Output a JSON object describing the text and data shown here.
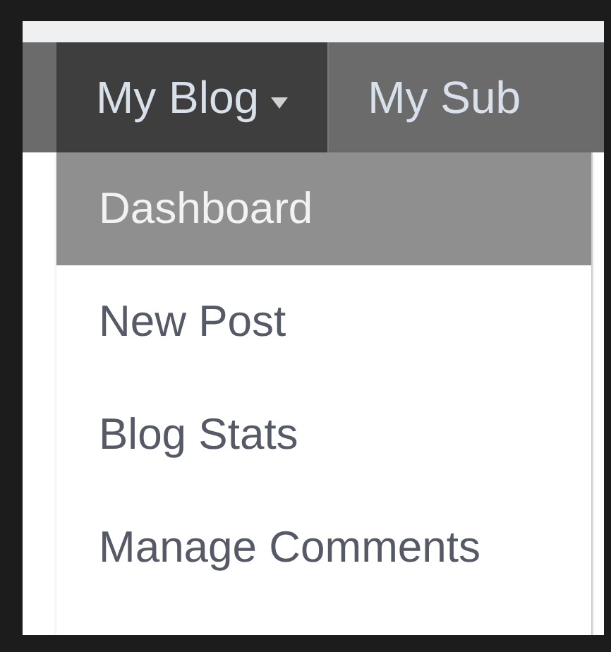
{
  "nav": {
    "tabs": [
      {
        "label": "My Blog",
        "selected": true,
        "has_caret": true
      },
      {
        "label": "My Sub",
        "selected": false,
        "has_caret": false
      }
    ]
  },
  "menu": {
    "items": [
      {
        "label": "Dashboard",
        "selected": true
      },
      {
        "label": "New Post",
        "selected": false
      },
      {
        "label": "Blog Stats",
        "selected": false
      },
      {
        "label": "Manage Comments",
        "selected": false
      }
    ]
  }
}
